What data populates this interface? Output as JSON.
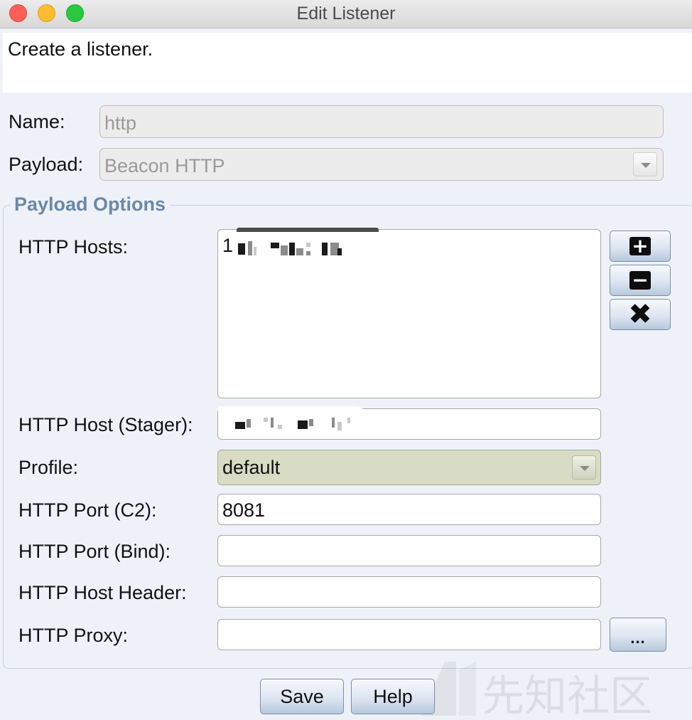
{
  "window": {
    "title": "Edit Listener"
  },
  "description": "Create a listener.",
  "form": {
    "name_label": "Name:",
    "name_value": "http",
    "payload_label": "Payload:",
    "payload_value": "Beacon HTTP"
  },
  "payload_options": {
    "group_title": "Payload Options",
    "http_hosts_label": "HTTP Hosts:",
    "http_hosts_prefix": "1",
    "http_host_stager_label": "HTTP Host (Stager):",
    "profile_label": "Profile:",
    "profile_value": "default",
    "http_port_c2_label": "HTTP Port (C2):",
    "http_port_c2_value": "8081",
    "http_port_bind_label": "HTTP Port (Bind):",
    "http_port_bind_value": "",
    "http_host_header_label": "HTTP Host Header:",
    "http_host_header_value": "",
    "http_proxy_label": "HTTP Proxy:",
    "http_proxy_value": "",
    "proxy_button_label": "...",
    "add_icon": "plus-icon",
    "remove_icon": "minus-icon",
    "clear_icon": "x-icon"
  },
  "buttons": {
    "save": "Save",
    "help": "Help"
  },
  "watermark": "先知社区",
  "colors": {
    "group_title": "#6a88a8",
    "profile_background": "#d8dcc4"
  }
}
